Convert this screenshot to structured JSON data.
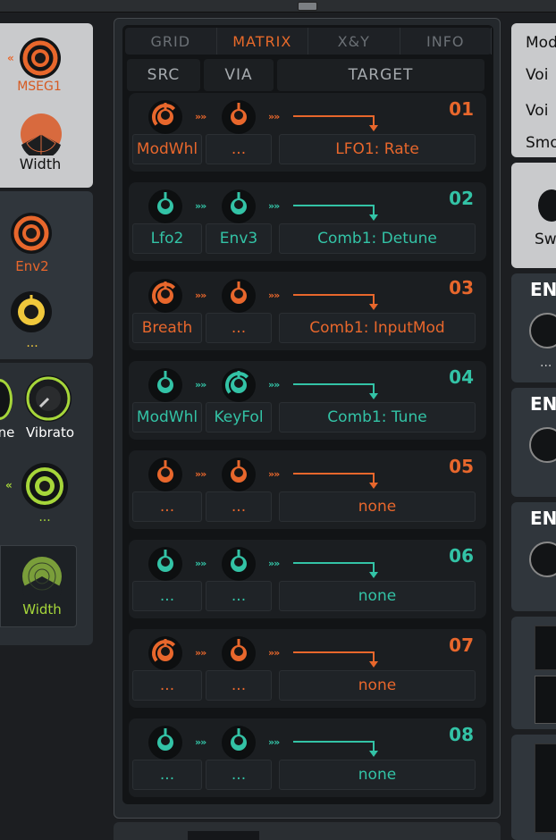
{
  "colors": {
    "orange": "#e8672c",
    "teal": "#33c3a6",
    "green": "#a6d63a",
    "yellow": "#f0c83c"
  },
  "tabs": [
    "GRID",
    "MATRIX",
    "X&Y",
    "INFO"
  ],
  "active_tab": "MATRIX",
  "headers": {
    "src": "SRC",
    "via": "VIA",
    "target": "TARGET"
  },
  "slots": [
    {
      "num": "01",
      "color": "orange",
      "src": "ModWhl",
      "via": "...",
      "target": "LFO1: Rate"
    },
    {
      "num": "02",
      "color": "teal",
      "src": "Lfo2",
      "via": "Env3",
      "target": "Comb1: Detune"
    },
    {
      "num": "03",
      "color": "orange",
      "src": "Breath",
      "via": "...",
      "target": "Comb1: InputMod"
    },
    {
      "num": "04",
      "color": "teal",
      "src": "ModWhl",
      "via": "KeyFol",
      "target": "Comb1: Tune"
    },
    {
      "num": "05",
      "color": "orange",
      "src": "...",
      "via": "...",
      "target": "none"
    },
    {
      "num": "06",
      "color": "teal",
      "src": "...",
      "via": "...",
      "target": "none"
    },
    {
      "num": "07",
      "color": "orange",
      "src": "...",
      "via": "...",
      "target": "none"
    },
    {
      "num": "08",
      "color": "teal",
      "src": "...",
      "via": "...",
      "target": "none"
    }
  ],
  "left": {
    "mseg_label": "MSEG1",
    "width_label": "Width",
    "env2_label": "Env2",
    "dots1": "...",
    "partial_label": "ne",
    "vibrato_label": "Vibrato",
    "dots2": "...",
    "width2_label": "Width"
  },
  "right": {
    "mod": "Mod",
    "voi1": "Voi",
    "voi2": "Voi",
    "smo": "Smo",
    "sw": "Sw",
    "env1": "EN",
    "env2": "ENV",
    "env3": "EN",
    "dots": "..."
  }
}
